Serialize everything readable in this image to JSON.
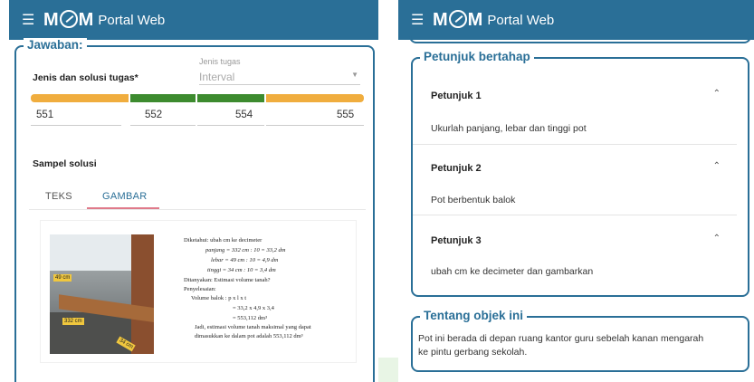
{
  "app": {
    "logo_left": "M",
    "logo_right": "M",
    "title": "Portal Web"
  },
  "left": {
    "legend": "Jawaban:",
    "task_type_label": "Jenis dan solusi tugas*",
    "task_type_field_label": "Jenis tugas",
    "task_type_value": "Interval",
    "interval_values": [
      "551",
      "552",
      "554",
      "555"
    ],
    "sample_label": "Sampel solusi",
    "tabs": [
      "TEKS",
      "GAMBAR"
    ],
    "active_tab": "GAMBAR",
    "photo_labels": [
      "49 cm",
      "332 cm",
      "34 cm"
    ],
    "solution_lines": [
      "Diketahui: ubah cm ke decimeter",
      "panjang = 332 cm : 10 = 33,2 dm",
      "lebar = 49 cm : 10 = 4,9 dm",
      "tinggi = 34 cm : 10 = 3,4 dm",
      "Ditanyakan: Estimasi volume tanah?",
      "Penyelesaian:",
      "Volume balok : p x l x t",
      "= 33,2 x 4,9 x 3,4",
      "= 553,112 dm³",
      "Jadi, estimasi volume tanah maksimal yang dapat",
      "dimasukkan ke dalam pot adalah 553,112 dm³"
    ]
  },
  "right": {
    "hints_legend": "Petunjuk bertahap",
    "hints": [
      {
        "title": "Petunjuk 1",
        "text": "Ukurlah panjang, lebar dan tinggi pot"
      },
      {
        "title": "Petunjuk 2",
        "text": "Pot berbentuk balok"
      },
      {
        "title": "Petunjuk 3",
        "text": "ubah cm ke decimeter dan gambarkan"
      }
    ],
    "about_legend": "Tentang objek ini",
    "about_lines": [
      "Pot ini berada di depan ruang kantor guru sebelah kanan mengarah",
      "ke pintu gerbang sekolah."
    ]
  },
  "colors": {
    "primary": "#2a6f97",
    "orange": "#f0ad3e",
    "green": "#3d8b2f",
    "tab_underline": "#e07a8a"
  },
  "icons": {
    "menu": "menu-icon",
    "dropdown": "chevron-down-icon",
    "collapse": "chevron-up-icon"
  }
}
